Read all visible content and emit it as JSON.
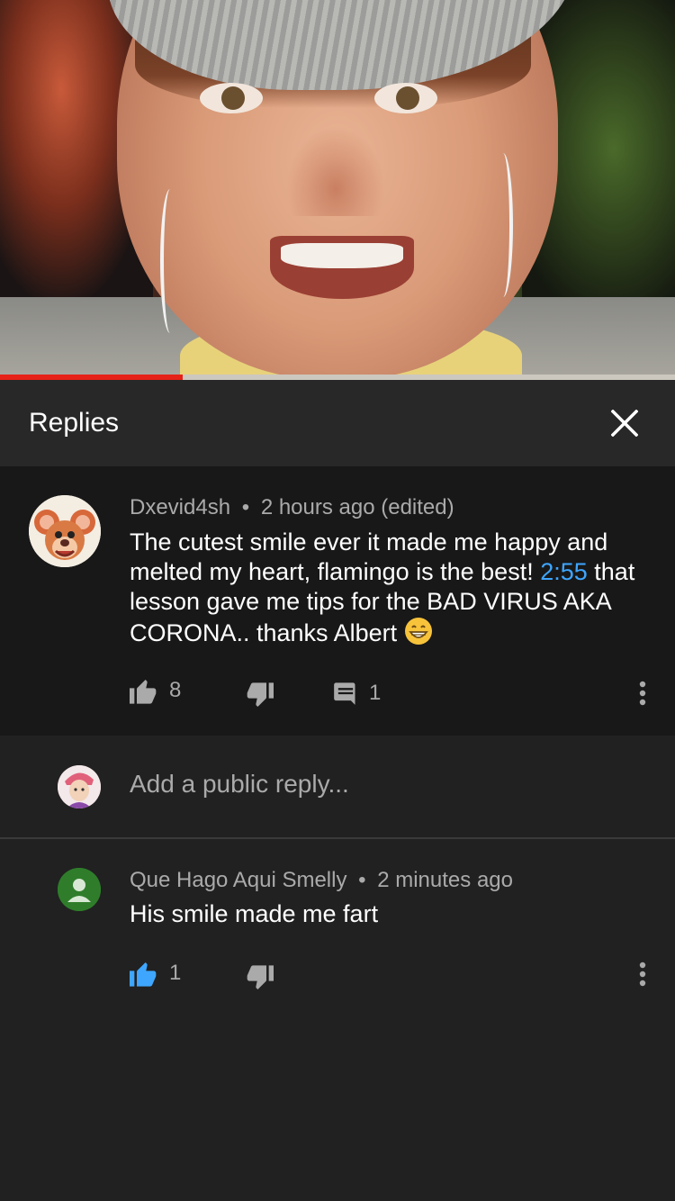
{
  "video": {
    "progress_percent": 27,
    "played_color": "#e62117"
  },
  "header": {
    "title": "Replies",
    "close_icon": "close-icon"
  },
  "parent_comment": {
    "author": "Dxevid4sh",
    "separator": "•",
    "time": "2 hours ago (edited)",
    "text_before": "The cutest smile ever it made me happy and melted my heart, flamingo is the best! ",
    "timestamp_link": "2:55",
    "text_after": " that lesson gave me tips for the BAD VIRUS AKA CORONA.. thanks Albert ",
    "emoji": "grinning-face-emoji",
    "likes": "8",
    "replies": "1",
    "icons": [
      "thumbs-up-icon",
      "thumbs-down-icon",
      "reply-comment-icon",
      "more-vertical-icon"
    ]
  },
  "add_reply": {
    "placeholder": "Add a public reply..."
  },
  "reply": {
    "author": "Que Hago Aqui Smelly",
    "separator": "•",
    "time": "2 minutes ago",
    "text": "His smile made me fart",
    "likes": "1",
    "liked": true,
    "like_color": "#3ea6ff"
  }
}
